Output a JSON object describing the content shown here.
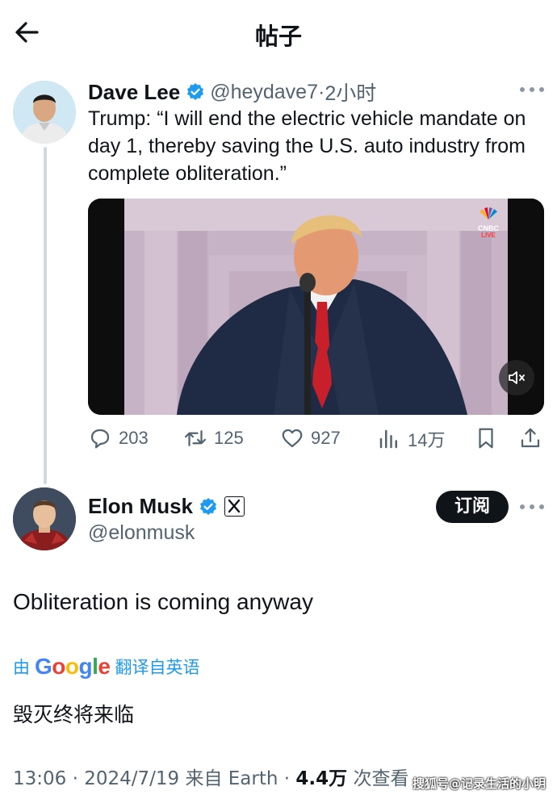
{
  "header": {
    "title": "帖子"
  },
  "colors": {
    "verified_blue": "#1d9bf0",
    "text": "#0f1419",
    "muted": "#536471",
    "button_bg": "#0f1419"
  },
  "parent_tweet": {
    "display_name": "Dave Lee",
    "handle": "@heydave7",
    "separator": "·",
    "time": "2小时",
    "text": "Trump: “I will end the electric vehicle mandate on day 1, thereby saving the U.S. auto industry from complete obliteration.”",
    "media": {
      "badge": "CNBC LIVE",
      "badge_line1": "CNBC",
      "badge_line2": "LIVE",
      "muted": true
    },
    "stats": {
      "replies": "203",
      "retweets": "125",
      "likes": "927",
      "views": "14万"
    }
  },
  "reply_tweet": {
    "display_name": "Elon Musk",
    "handle": "@elonmusk",
    "subscribe_label": "订阅",
    "text": "Obliteration is coming anyway",
    "translation": {
      "prefix": "由",
      "provider": "Google",
      "suffix": "翻译自英语",
      "translated_text": "毁灭终将来临"
    },
    "meta": {
      "time": "13:06 · 2024/7/19 来自 Earth · ",
      "views": "4.4万",
      "views_label": " 次查看"
    }
  },
  "watermark": "搜狐号@记录生活的小明",
  "icons": [
    "back-arrow-icon",
    "verified-badge-icon",
    "more-icon",
    "reply-icon",
    "retweet-icon",
    "like-icon",
    "views-icon",
    "bookmark-icon",
    "share-icon",
    "mute-icon",
    "x-logo-icon"
  ]
}
